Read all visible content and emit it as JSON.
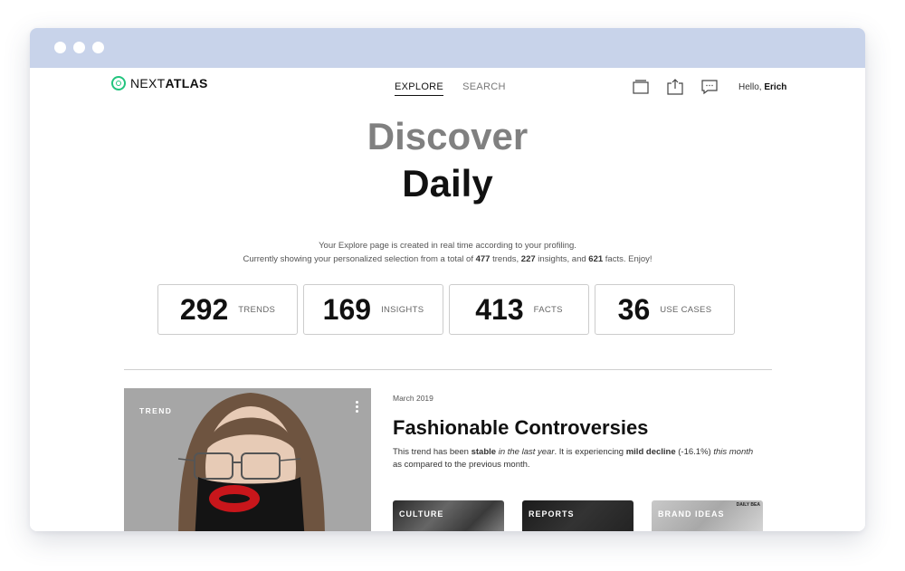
{
  "window": {
    "dots": [
      "dot-1",
      "dot-2",
      "dot-3"
    ]
  },
  "header": {
    "logo": {
      "part1": "NEXT",
      "part2": "ATLAS"
    },
    "nav": [
      {
        "label": "EXPLORE",
        "active": true
      },
      {
        "label": "SEARCH",
        "active": false
      }
    ],
    "icons": [
      "collections-icon",
      "share-icon",
      "chat-icon"
    ],
    "greeting_prefix": "Hello, ",
    "user_name": "Erich"
  },
  "hero": {
    "line1": "Discover",
    "line2": "Daily"
  },
  "description": {
    "line1": "Your Explore page is created in real time according to your profiling.",
    "line2_a": "Currently showing your personalized selection from a total of ",
    "trends_total": "477",
    "line2_b": " trends, ",
    "insights_total": "227",
    "line2_c": " insights, and ",
    "facts_total": "621",
    "line2_d": " facts. Enjoy!"
  },
  "stats": [
    {
      "value": "292",
      "label": "TRENDS"
    },
    {
      "value": "169",
      "label": "INSIGHTS"
    },
    {
      "value": "413",
      "label": "FACTS"
    },
    {
      "value": "36",
      "label": "USE CASES"
    }
  ],
  "card": {
    "label": "TREND"
  },
  "article": {
    "date": "March 2019",
    "title": "Fashionable Controversies",
    "body_a": "This trend has been ",
    "body_b": "stable",
    "body_c": " in the last year",
    "body_d": ". It is experiencing ",
    "body_e": "mild decline",
    "body_f": " (-16.1%) ",
    "body_g": "this month",
    "body_h": " as compared to the previous month."
  },
  "tags": [
    {
      "label": "CULTURE"
    },
    {
      "label": "REPORTS"
    },
    {
      "label": "BRAND IDEAS",
      "mini": "DAILY BEA"
    }
  ],
  "colors": {
    "titlebar": "#c8d3ea",
    "logo_accent": "#22c47e",
    "hero_gray": "#808080"
  }
}
